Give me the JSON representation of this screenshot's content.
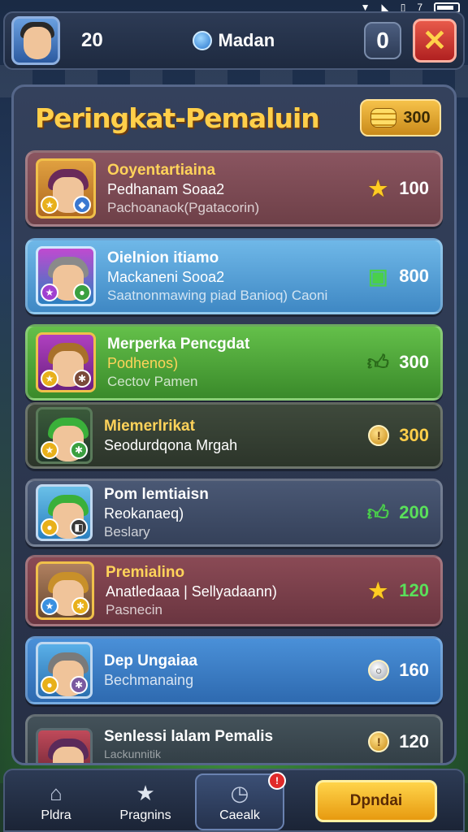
{
  "statusbar": {
    "time": "7"
  },
  "header": {
    "level": "20",
    "mode_label": "Madan",
    "counter": "0",
    "close_symbol": "✕"
  },
  "panel": {
    "title": "Peringkat-Pemaluin",
    "coins": "300"
  },
  "rows": [
    {
      "line1": "Ooyentartiaina",
      "line2": "Pedhanam Soaa2",
      "line3": "Pachoanaok(Pgatacorin)",
      "score": "100",
      "score_icon": "star-icon",
      "color": "red"
    },
    {
      "line1": "Oielnion itiamo",
      "line2": "Mackaneni Sooa2",
      "line3": "Saatnonmawing piad Banioq) Caoni",
      "score": "800",
      "score_icon": "thumbs-up-icon",
      "color": "blue"
    },
    {
      "line1": "Merperka Pencgdat",
      "line2": "Podhenos)",
      "line3": "Cectov Pamen",
      "score": "300",
      "score_icon": "thumbs-up-icon",
      "color": "green"
    },
    {
      "line1": "Miemerlrikat",
      "line2": "Seodurdqona Mrgah",
      "line3": "",
      "score": "300",
      "score_icon": "medal-icon",
      "color": "olive"
    },
    {
      "line1": "Pom lemtiaisn",
      "line2": "Reokanaeq)",
      "line3": "Beslary",
      "score": "200",
      "score_icon": "thumbs-up-icon",
      "color": "slate"
    },
    {
      "line1": "Premialino",
      "line2": "Anatledaaa | Sellyadaann)",
      "line3": "Pasnecin",
      "score": "120",
      "score_icon": "star-icon",
      "color": "rose"
    },
    {
      "line1": "Dep Ungaiaa",
      "line2": "Bechmanaing",
      "line3": "",
      "score": "160",
      "score_icon": "silver-medal-icon",
      "color": "sky"
    },
    {
      "line1": "Senlessi lalam Pemalis",
      "line2": "Lackunnitik",
      "line3": "",
      "score": "120",
      "score_icon": "medal-icon",
      "color": "dim"
    }
  ],
  "nav": {
    "items": [
      {
        "label": "Pldra",
        "icon": "home-icon"
      },
      {
        "label": "Pragnins",
        "icon": "star-icon"
      },
      {
        "label": "Caealk",
        "icon": "clock-icon",
        "badge": "!"
      }
    ],
    "cta_label": "Dpndai"
  }
}
